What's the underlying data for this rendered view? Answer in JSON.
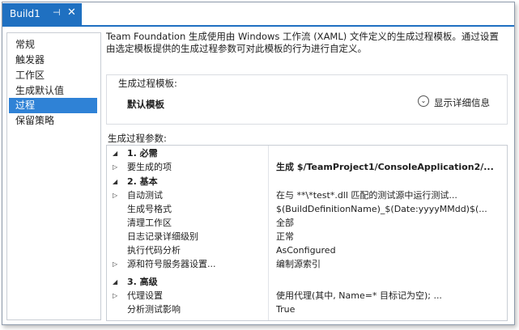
{
  "tab": {
    "title": "Build1",
    "pin_glyph": "⊣",
    "close_glyph": "✕"
  },
  "nav": {
    "items": [
      "常规",
      "触发器",
      "工作区",
      "生成默认值",
      "过程",
      "保留策略"
    ],
    "selected_index": 4
  },
  "description": "Team Foundation 生成使用由 Windows 工作流 (XAML) 文件定义的生成过程模板。通过设置由选定模板提供的生成过程参数可对此模板的行为进行自定义。",
  "template_group": {
    "label": "生成过程模板:",
    "value": "默认模板",
    "show_details_label": "显示详细信息"
  },
  "params": {
    "label": "生成过程参数:",
    "categories": [
      {
        "title": "1. 必需",
        "rows": [
          {
            "name": "要生成的项",
            "value": "生成 $/TeamProject1/ConsoleApplication2/...",
            "expandable": true,
            "bold": true
          }
        ]
      },
      {
        "title": "2. 基本",
        "rows": [
          {
            "name": "自动测试",
            "value": "在与 **\\*test*.dll 匹配的测试源中运行测试...",
            "expandable": true,
            "bold": false
          },
          {
            "name": "生成号格式",
            "value": "$(BuildDefinitionName)_$(Date:yyyyMMdd)$(...",
            "expandable": false,
            "bold": false
          },
          {
            "name": "清理工作区",
            "value": "全部",
            "expandable": false,
            "bold": false
          },
          {
            "name": "日志记录详细级别",
            "value": "正常",
            "expandable": false,
            "bold": false
          },
          {
            "name": "执行代码分析",
            "value": "AsConfigured",
            "expandable": false,
            "bold": false
          },
          {
            "name": "源和符号服务器设置...",
            "value": "编制源索引",
            "expandable": true,
            "bold": false
          }
        ]
      },
      {
        "title": "3. 高级",
        "rows": [
          {
            "name": "代理设置",
            "value": "使用代理(其中, Name=* 目标记为空); ...",
            "expandable": true,
            "bold": false
          },
          {
            "name": "分析测试影响",
            "value": "True",
            "expandable": false,
            "bold": false
          }
        ]
      }
    ]
  },
  "colors": {
    "accent": "#1f70c1",
    "selection": "#2f82d6",
    "border": "#c8cdd4"
  },
  "glyphs": {
    "collapsed": "▷",
    "expanded": "◢",
    "chevron": "⌄"
  }
}
